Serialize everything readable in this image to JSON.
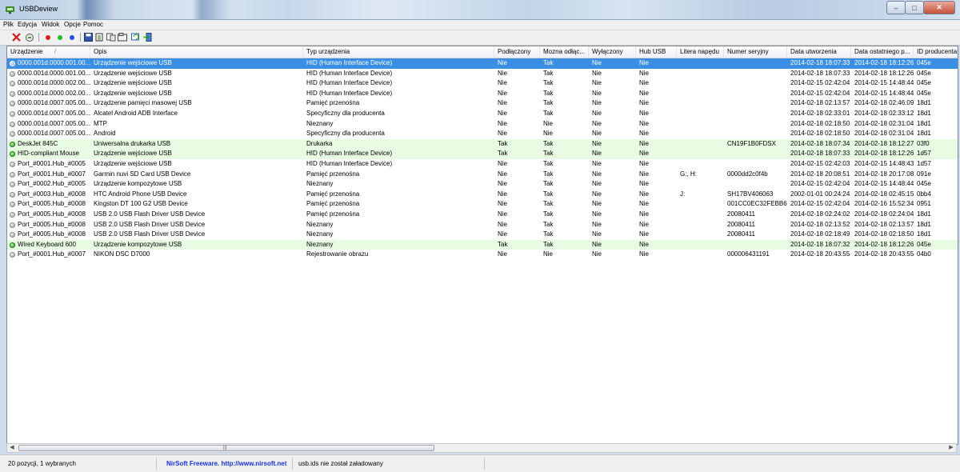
{
  "window": {
    "title": "USBDeview",
    "buttons": {
      "minimize": "–",
      "maximize": "□",
      "close": "✕"
    }
  },
  "menu": [
    "Plik",
    "Edycja",
    "Widok",
    "Opcje",
    "Pomoc"
  ],
  "toolbar": {
    "icons": [
      "uninstall-x-icon",
      "disconnect-icon",
      "red-dot-icon",
      "green-dot-icon",
      "blue-dot-icon",
      "save-icon",
      "copy-icon",
      "html-report-icon",
      "properties-icon",
      "refresh-icon",
      "exit-icon"
    ],
    "colors": {
      "red": "#e11b1b",
      "green": "#1fbf1f",
      "blue": "#1c4fe0"
    }
  },
  "columns": [
    "Urządzenie",
    "Opis",
    "Typ urządzenia",
    "Podłączony",
    "Mozna odłąc...",
    "Wyłączony",
    "Hub USB",
    "Litera napędu",
    "Numer seryjny",
    "Data utworzenia",
    "Data ostatniego p...",
    "ID producenta"
  ],
  "sort_indicator": "/",
  "rows": [
    {
      "status": "blue",
      "sel": true,
      "green": false,
      "c": [
        "0000.001d.0000.001.00...",
        "Urządzenie wejściowe USB",
        "HID (Human Interface Device)",
        "Nie",
        "Tak",
        "Nie",
        "Nie",
        "",
        "",
        "2014-02-18 18:07:33",
        "2014-02-18 18:12:26",
        "045e"
      ]
    },
    {
      "status": "gray",
      "sel": false,
      "green": false,
      "c": [
        "0000.001d.0000.001.00...",
        "Urządzenie wejściowe USB",
        "HID (Human Interface Device)",
        "Nie",
        "Tak",
        "Nie",
        "Nie",
        "",
        "",
        "2014-02-18 18:07:33",
        "2014-02-18 18:12:26",
        "045e"
      ]
    },
    {
      "status": "gray",
      "sel": false,
      "green": false,
      "c": [
        "0000.001d.0000.002.00...",
        "Urządzenie wejściowe USB",
        "HID (Human Interface Device)",
        "Nie",
        "Tak",
        "Nie",
        "Nie",
        "",
        "",
        "2014-02-15 02:42:04",
        "2014-02-15 14:48:44",
        "045e"
      ]
    },
    {
      "status": "gray",
      "sel": false,
      "green": false,
      "c": [
        "0000.001d.0000.002.00...",
        "Urządzenie wejściowe USB",
        "HID (Human Interface Device)",
        "Nie",
        "Tak",
        "Nie",
        "Nie",
        "",
        "",
        "2014-02-15 02:42:04",
        "2014-02-15 14:48:44",
        "045e"
      ]
    },
    {
      "status": "gray",
      "sel": false,
      "green": false,
      "c": [
        "0000.001d.0007.005.00...",
        "Urządzenie pamięci masowej USB",
        "Pamięć przenośna",
        "Nie",
        "Tak",
        "Nie",
        "Nie",
        "",
        "",
        "2014-02-18 02:13:57",
        "2014-02-18 02:46:09",
        "18d1"
      ]
    },
    {
      "status": "gray",
      "sel": false,
      "green": false,
      "c": [
        "0000.001d.0007.005.00...",
        "Alcatel Android ADB Interface",
        "Specyficzny dla producenta",
        "Nie",
        "Tak",
        "Nie",
        "Nie",
        "",
        "",
        "2014-02-18 02:33:01",
        "2014-02-18 02:33:12",
        "18d1"
      ]
    },
    {
      "status": "gray",
      "sel": false,
      "green": false,
      "c": [
        "0000.001d.0007.005.00...",
        "MTP",
        "Nieznany",
        "Nie",
        "Nie",
        "Nie",
        "Nie",
        "",
        "",
        "2014-02-18 02:18:50",
        "2014-02-18 02:31:04",
        "18d1"
      ]
    },
    {
      "status": "gray",
      "sel": false,
      "green": false,
      "c": [
        "0000.001d.0007.005.00...",
        "Android",
        "Specyficzny dla producenta",
        "Nie",
        "Nie",
        "Nie",
        "Nie",
        "",
        "",
        "2014-02-18 02:18:50",
        "2014-02-18 02:31:04",
        "18d1"
      ]
    },
    {
      "status": "green",
      "sel": false,
      "green": true,
      "c": [
        "DeskJet 845C",
        "Uniwersalna drukarka USB",
        "Drukarka",
        "Tak",
        "Tak",
        "Nie",
        "Nie",
        "",
        "CN19F1B0FDSX",
        "2014-02-18 18:07:34",
        "2014-02-18 18:12:27",
        "03f0"
      ]
    },
    {
      "status": "green",
      "sel": false,
      "green": true,
      "c": [
        "HID-compliant Mouse",
        "Urządzenie wejściowe USB",
        "HID (Human Interface Device)",
        "Tak",
        "Tak",
        "Nie",
        "Nie",
        "",
        "",
        "2014-02-18 18:07:33",
        "2014-02-18 18:12:26",
        "1d57"
      ]
    },
    {
      "status": "gray",
      "sel": false,
      "green": false,
      "c": [
        "Port_#0001.Hub_#0005",
        "Urządzenie wejściowe USB",
        "HID (Human Interface Device)",
        "Nie",
        "Tak",
        "Nie",
        "Nie",
        "",
        "",
        "2014-02-15 02:42:03",
        "2014-02-15 14:48:43",
        "1d57"
      ]
    },
    {
      "status": "gray",
      "sel": false,
      "green": false,
      "c": [
        "Port_#0001.Hub_#0007",
        "Garmin nuvi SD Card USB Device",
        "Pamięć przenośna",
        "Nie",
        "Tak",
        "Nie",
        "Nie",
        "G:, H:",
        "0000dd2c0f4b",
        "2014-02-18 20:08:51",
        "2014-02-18 20:17:08",
        "091e"
      ]
    },
    {
      "status": "gray",
      "sel": false,
      "green": false,
      "c": [
        "Port_#0002.Hub_#0005",
        "Urządzenie kompozytowe USB",
        "Nieznany",
        "Nie",
        "Tak",
        "Nie",
        "Nie",
        "",
        "",
        "2014-02-15 02:42:04",
        "2014-02-15 14:48:44",
        "045e"
      ]
    },
    {
      "status": "gray",
      "sel": false,
      "green": false,
      "c": [
        "Port_#0003.Hub_#0008",
        "HTC Android Phone USB Device",
        "Pamięć przenośna",
        "Nie",
        "Tak",
        "Nie",
        "Nie",
        "J:",
        "SH17BV406063",
        "2002-01-01 00:24:24",
        "2014-02-18 02:45:15",
        "0bb4"
      ]
    },
    {
      "status": "gray",
      "sel": false,
      "green": false,
      "c": [
        "Port_#0005.Hub_#0008",
        "Kingston DT 100 G2 USB Device",
        "Pamięć przenośna",
        "Nie",
        "Tak",
        "Nie",
        "Nie",
        "",
        "001CC0EC32FEBB6...",
        "2014-02-15 02:42:04",
        "2014-02-16 15:52:34",
        "0951"
      ]
    },
    {
      "status": "gray",
      "sel": false,
      "green": false,
      "c": [
        "Port_#0005.Hub_#0008",
        "USB 2.0 USB Flash Driver USB Device",
        "Pamięć przenośna",
        "Nie",
        "Tak",
        "Nie",
        "Nie",
        "",
        "20080411",
        "2014-02-18 02:24:02",
        "2014-02-18 02:24:04",
        "18d1"
      ]
    },
    {
      "status": "gray",
      "sel": false,
      "green": false,
      "c": [
        "Port_#0005.Hub_#0008",
        "USB 2.0 USB Flash Driver USB Device",
        "Nieznany",
        "Nie",
        "Tak",
        "Nie",
        "Nie",
        "",
        "20080411",
        "2014-02-18 02:13:52",
        "2014-02-18 02:13:57",
        "18d1"
      ]
    },
    {
      "status": "gray",
      "sel": false,
      "green": false,
      "c": [
        "Port_#0005.Hub_#0008",
        "USB 2.0 USB Flash Driver USB Device",
        "Nieznany",
        "Nie",
        "Tak",
        "Nie",
        "Nie",
        "",
        "20080411",
        "2014-02-18 02:18:49",
        "2014-02-18 02:18:50",
        "18d1"
      ]
    },
    {
      "status": "green",
      "sel": false,
      "green": true,
      "c": [
        "Wired Keyboard 600",
        "Urządzenie kompozytowe USB",
        "Nieznany",
        "Tak",
        "Tak",
        "Nie",
        "Nie",
        "",
        "",
        "2014-02-18 18:07:32",
        "2014-02-18 18:12:26",
        "045e"
      ]
    },
    {
      "status": "gray",
      "sel": false,
      "green": false,
      "c": [
        "Port_#0001.Hub_#0007",
        "NIKON DSC D7000",
        "Rejestrowanie obrazu",
        "Nie",
        "Nie",
        "Nie",
        "Nie",
        "",
        "000006431191",
        "2014-02-18 20:43:55",
        "2014-02-18 20:43:55",
        "04b0"
      ]
    }
  ],
  "scrollbar": {
    "left_arrow": "◀",
    "right_arrow": "▶",
    "grip": "|||"
  },
  "status": {
    "count": "20 pozycji, 1 wybranych",
    "link": "NirSoft Freeware.  http://www.nirsoft.net",
    "message": "usb.ids nie został załadowany"
  }
}
